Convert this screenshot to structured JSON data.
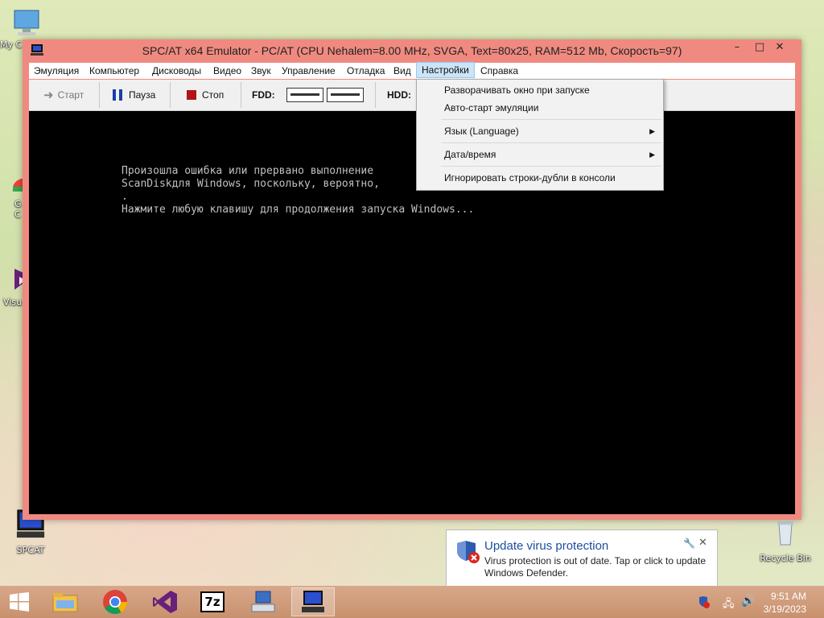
{
  "desktop": {
    "icons": [
      {
        "label": "My C"
      },
      {
        "label": "G\nC"
      },
      {
        "label": "Visu"
      },
      {
        "label": "SPCAT"
      },
      {
        "label": "Recycle Bin"
      }
    ]
  },
  "window": {
    "title": "SPC/AT x64 Emulator - PC/AT (CPU Nehalem=8.00 MHz, SVGA, Text=80x25, RAM=512 Mb, Скорость=97)",
    "controls": {
      "minimize": "–",
      "maximize": "□",
      "close": "✕"
    },
    "menu": [
      "Эмуляция",
      "Компьютер",
      "Дисководы",
      "Видео",
      "Звук",
      "Управление",
      "Отладка",
      "Вид",
      "Настройки",
      "Справка"
    ],
    "toolbar": {
      "start_label": "Старт",
      "pause_label": "Пауза",
      "stop_label": "Стоп",
      "fdd_label": "FDD:",
      "hdd_label": "HDD:"
    },
    "console_lines": [
      "Произошла ошибка или прервано выполнение",
      "ScanDiskдля Windows, поскольку, вероятно,                    анены",
      ".",
      "Нажмите любую клавишу для продолжения запуска Windows..."
    ]
  },
  "settings_menu": {
    "items": [
      {
        "label": "Разворачивать окно при запуске",
        "submenu": false
      },
      {
        "label": "Авто-старт эмуляции",
        "submenu": false
      },
      {
        "label": "Язык (Language)",
        "submenu": true
      },
      {
        "label": "Дата/время",
        "submenu": true
      },
      {
        "label": "Игнорировать строки-дубли в консоли",
        "submenu": false
      }
    ],
    "arrow": "▶"
  },
  "notification": {
    "title": "Update virus protection",
    "body": "Virus protection is out of date. Tap or click to update Windows Defender."
  },
  "taskbar": {
    "apps": [
      "file-explorer-icon",
      "chrome-icon",
      "visual-studio-icon",
      "7zip-icon",
      "keyboard-app-icon",
      "spcat-icon"
    ],
    "sevenzip_label": "7z",
    "time": "9:51 AM",
    "date": "3/19/2023"
  },
  "colors": {
    "window_frame": "#f08a80",
    "menu_highlight": "#cce4f7",
    "console_bg": "#000000",
    "console_text": "#c0c0c0",
    "notification_title": "#1a4fa0"
  }
}
